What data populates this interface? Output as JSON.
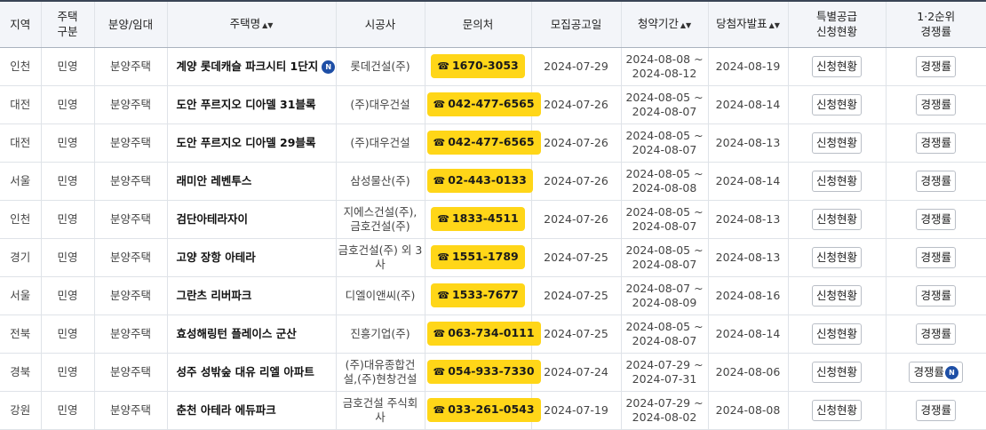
{
  "table": {
    "headers": {
      "region": "지역",
      "housing_type": "주택\n구분",
      "sale_rent": "분양/임대",
      "name": "주택명",
      "builder": "시공사",
      "contact": "문의처",
      "notice_date": "모집공고일",
      "subscription_period": "청약기간",
      "winner_announcement": "당첨자발표",
      "special_supply": "특별공급\n신청현황",
      "competition": "1·2순위\n경쟁률"
    },
    "sort_icon": "▲▼",
    "new_badge": "N",
    "phone_icon": "☎",
    "status_button": "신청현황",
    "competition_button": "경쟁률",
    "rows": [
      {
        "region": "인천",
        "type": "민영",
        "kind": "분양주택",
        "name": "계양 롯데캐슬 파크시티 1단지",
        "name_new": true,
        "builder": "롯데건설(주)",
        "phone": "1670-3053",
        "notice": "2024-07-29",
        "period_start": "2024-08-08 ~",
        "period_end": "2024-08-12",
        "winner": "2024-08-19",
        "comp_new": false
      },
      {
        "region": "대전",
        "type": "민영",
        "kind": "분양주택",
        "name": "도안 푸르지오 디아델 31블록",
        "name_new": false,
        "builder": "(주)대우건설",
        "phone": "042-477-6565",
        "notice": "2024-07-26",
        "period_start": "2024-08-05 ~",
        "period_end": "2024-08-07",
        "winner": "2024-08-14",
        "comp_new": false
      },
      {
        "region": "대전",
        "type": "민영",
        "kind": "분양주택",
        "name": "도안 푸르지오 디아델 29블록",
        "name_new": false,
        "builder": "(주)대우건설",
        "phone": "042-477-6565",
        "notice": "2024-07-26",
        "period_start": "2024-08-05 ~",
        "period_end": "2024-08-07",
        "winner": "2024-08-13",
        "comp_new": false
      },
      {
        "region": "서울",
        "type": "민영",
        "kind": "분양주택",
        "name": "래미안 레벤투스",
        "name_new": false,
        "builder": "삼성물산(주)",
        "phone": "02-443-0133",
        "notice": "2024-07-26",
        "period_start": "2024-08-05 ~",
        "period_end": "2024-08-08",
        "winner": "2024-08-14",
        "comp_new": false
      },
      {
        "region": "인천",
        "type": "민영",
        "kind": "분양주택",
        "name": "검단아테라자이",
        "name_new": false,
        "builder": "지에스건설(주),\n금호건설(주)",
        "phone": "1833-4511",
        "notice": "2024-07-26",
        "period_start": "2024-08-05 ~",
        "period_end": "2024-08-07",
        "winner": "2024-08-13",
        "comp_new": false
      },
      {
        "region": "경기",
        "type": "민영",
        "kind": "분양주택",
        "name": "고양 장항 아테라",
        "name_new": false,
        "builder": "금호건설(주) 외 3\n사",
        "phone": "1551-1789",
        "notice": "2024-07-25",
        "period_start": "2024-08-05 ~",
        "period_end": "2024-08-07",
        "winner": "2024-08-13",
        "comp_new": false
      },
      {
        "region": "서울",
        "type": "민영",
        "kind": "분양주택",
        "name": "그란츠 리버파크",
        "name_new": false,
        "builder": "디엘이앤씨(주)",
        "phone": "1533-7677",
        "notice": "2024-07-25",
        "period_start": "2024-08-07 ~",
        "period_end": "2024-08-09",
        "winner": "2024-08-16",
        "comp_new": false
      },
      {
        "region": "전북",
        "type": "민영",
        "kind": "분양주택",
        "name": "효성해링턴 플레이스 군산",
        "name_new": false,
        "builder": "진흥기업(주)",
        "phone": "063-734-0111",
        "notice": "2024-07-25",
        "period_start": "2024-08-05 ~",
        "period_end": "2024-08-07",
        "winner": "2024-08-14",
        "comp_new": false
      },
      {
        "region": "경북",
        "type": "민영",
        "kind": "분양주택",
        "name": "성주 성밖숲 대유 리엘 아파트",
        "name_new": false,
        "builder": "(주)대유종합건\n설,(주)현창건설",
        "phone": "054-933-7330",
        "notice": "2024-07-24",
        "period_start": "2024-07-29 ~",
        "period_end": "2024-07-31",
        "winner": "2024-08-06",
        "comp_new": true
      },
      {
        "region": "강원",
        "type": "민영",
        "kind": "분양주택",
        "name": "춘천 아테라 에듀파크",
        "name_new": false,
        "builder": "금호건설 주식회\n사",
        "phone": "033-261-0543",
        "notice": "2024-07-19",
        "period_start": "2024-07-29 ~",
        "period_end": "2024-08-02",
        "winner": "2024-08-08",
        "comp_new": false
      }
    ]
  },
  "colors": {
    "phone_badge": "#ffd618",
    "new_badge": "#1e4fa6",
    "header_bg": "#f3f5f9",
    "header_top_border": "#3a4556"
  }
}
